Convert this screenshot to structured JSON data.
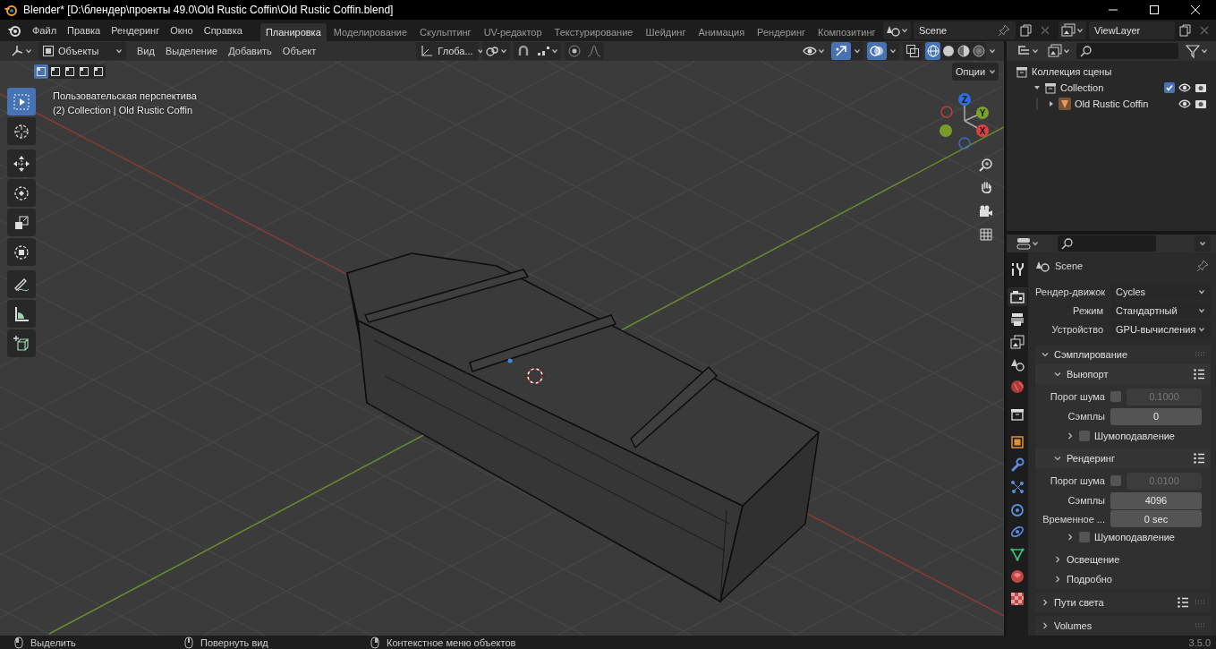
{
  "window": {
    "title": "Blender* [D:\\блендер\\проекты 49.0\\Old Rustic Coffin\\Old Rustic Coffin.blend]"
  },
  "menu": [
    "Файл",
    "Правка",
    "Рендеринг",
    "Окно",
    "Справка"
  ],
  "workspaces": [
    {
      "label": "Планировка",
      "selected": true
    },
    {
      "label": "Моделирование",
      "selected": false
    },
    {
      "label": "Скульптинг",
      "selected": false
    },
    {
      "label": "UV-редактор",
      "selected": false
    },
    {
      "label": "Текстурирование",
      "selected": false
    },
    {
      "label": "Шейдинг",
      "selected": false
    },
    {
      "label": "Анимация",
      "selected": false
    },
    {
      "label": "Рендеринг",
      "selected": false
    },
    {
      "label": "Композитинг",
      "selected": false
    }
  ],
  "scene": {
    "name": "Scene"
  },
  "view_layer": {
    "name": "ViewLayer"
  },
  "viewport": {
    "mode": "Объекты",
    "menus": [
      "Вид",
      "Выделение",
      "Добавить",
      "Объект"
    ],
    "orientation": "Глоба...",
    "gizmos_on": true,
    "overlays_on": true,
    "xray_on": false,
    "shading": [
      {
        "kind": "wireframe",
        "selected": true
      },
      {
        "kind": "solid",
        "selected": false
      },
      {
        "kind": "material",
        "selected": false
      },
      {
        "kind": "rendered",
        "selected": false
      }
    ],
    "select_modes": [
      {
        "selected": true
      },
      {
        "selected": false
      },
      {
        "selected": false
      },
      {
        "selected": false
      },
      {
        "selected": false
      }
    ],
    "options": "Опции",
    "overlay_text": [
      "Пользовательская перспектива",
      "(2) Collection | Old Rustic Coffin"
    ],
    "tools": [
      {
        "kind": "select",
        "selected": true
      },
      {
        "kind": "cursor",
        "selected": false
      },
      {
        "kind": "move",
        "selected": false
      },
      {
        "kind": "rotate",
        "selected": false
      },
      {
        "kind": "scale",
        "selected": false
      },
      {
        "kind": "transform",
        "selected": false
      },
      {
        "kind": "annotate",
        "selected": false
      },
      {
        "kind": "measure",
        "selected": false
      },
      {
        "kind": "add_cube",
        "selected": false
      }
    ],
    "gizmo_axes": [
      "Z",
      "Y",
      "X"
    ]
  },
  "outliner": {
    "items": [
      {
        "label": "Коллекция сцены",
        "kind": "scene_collection",
        "children": [
          {
            "label": "Collection",
            "kind": "collection",
            "expanded": true,
            "checked": true,
            "visible": true,
            "renderable": true,
            "children": [
              {
                "label": "Old Rustic Coffin",
                "kind": "object",
                "expanded": false,
                "visible": true,
                "renderable": true
              }
            ]
          }
        ]
      }
    ]
  },
  "properties": {
    "context": "Scene",
    "tabs": [
      {
        "kind": "tool",
        "selected": false
      },
      {
        "kind": "render",
        "selected": true
      },
      {
        "kind": "output",
        "selected": false
      },
      {
        "kind": "view_layer",
        "selected": false
      },
      {
        "kind": "scene",
        "selected": false
      },
      {
        "kind": "world",
        "selected": false
      },
      {
        "kind": "collection",
        "selected": false
      },
      {
        "kind": "object",
        "selected": false
      },
      {
        "kind": "modifiers",
        "selected": false
      },
      {
        "kind": "particles",
        "selected": false
      },
      {
        "kind": "physics",
        "selected": false
      },
      {
        "kind": "constraints",
        "selected": false
      },
      {
        "kind": "data",
        "selected": false
      },
      {
        "kind": "material",
        "selected": false
      },
      {
        "kind": "texture",
        "selected": false
      }
    ],
    "fields": [
      {
        "label": "Рендер-движок",
        "value": "Cycles"
      },
      {
        "label": "Режим",
        "value": "Стандартный"
      },
      {
        "label": "Устройство",
        "value": "GPU-вычисления"
      }
    ],
    "panels": [
      {
        "title": "Сэмплирование",
        "expanded": true,
        "children": [
          {
            "title": "Выюпорт",
            "expanded": true,
            "presets": true,
            "rows": [
              {
                "kind": "toggle_number",
                "label": "Порог шума",
                "checked": false,
                "value": "0.1000",
                "disabled": true
              },
              {
                "kind": "number",
                "label": "Сэмплы",
                "value": "0"
              }
            ],
            "children": [
              {
                "title": "Шумоподавление",
                "expanded": false,
                "checked": false
              }
            ]
          },
          {
            "title": "Рендеринг",
            "expanded": true,
            "presets": true,
            "rows": [
              {
                "kind": "toggle_number",
                "label": "Порог шума",
                "checked": false,
                "value": "0.0100",
                "disabled": true
              },
              {
                "kind": "number",
                "label": "Сэмплы",
                "value": "4096"
              },
              {
                "kind": "number",
                "label": "Временное ...",
                "value": "0 sec"
              }
            ],
            "children": [
              {
                "title": "Шумоподавление",
                "expanded": false,
                "checked": false
              }
            ]
          },
          {
            "title": "Освещение",
            "expanded": false
          },
          {
            "title": "Подробно",
            "expanded": false
          }
        ]
      },
      {
        "title": "Пути света",
        "expanded": false,
        "presets": true
      },
      {
        "title": "Volumes",
        "expanded": false
      }
    ]
  },
  "status_bar": {
    "hints": [
      "Выделить",
      "Повернуть вид",
      "Контекстное меню объектов"
    ],
    "version": "3.5.0"
  }
}
